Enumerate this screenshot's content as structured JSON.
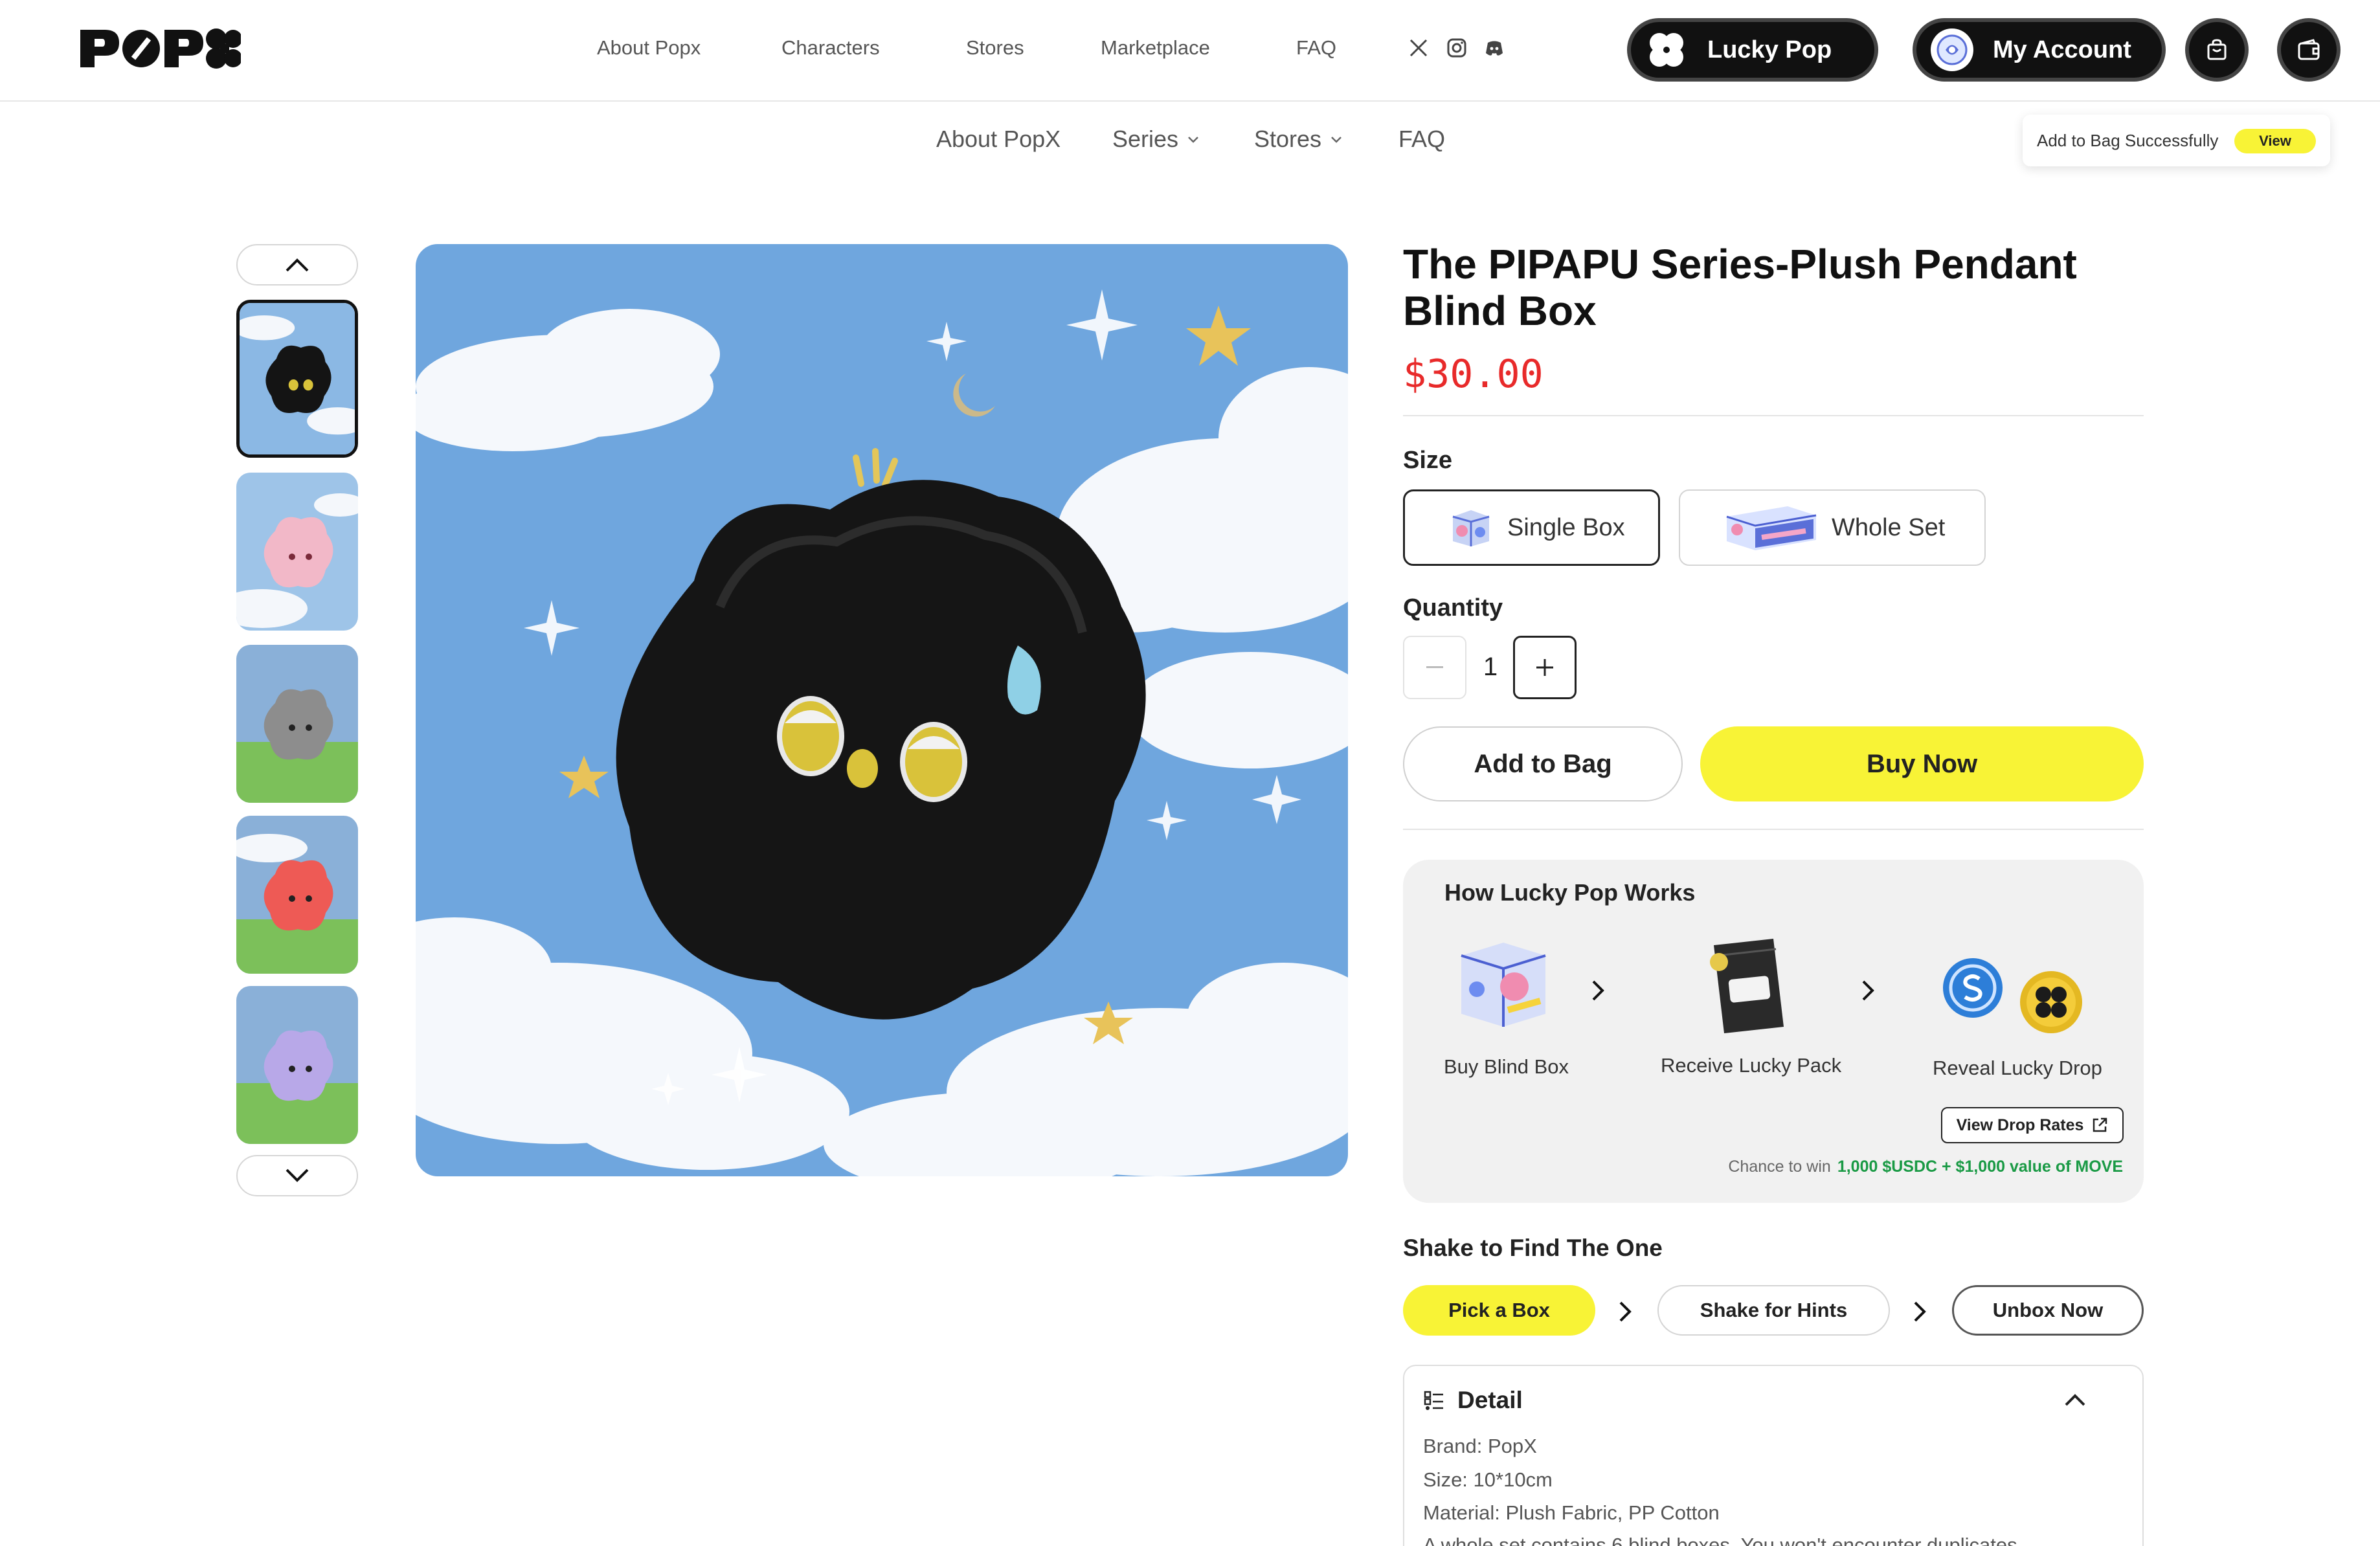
{
  "header": {
    "brand": "POPX",
    "nav": [
      "About Popx",
      "Characters",
      "Stores",
      "Marketplace",
      "FAQ"
    ],
    "social_icons": [
      "x-icon",
      "instagram-icon",
      "discord-icon"
    ],
    "lucky_pop_label": "Lucky Pop",
    "account_label": "My Account"
  },
  "subnav": {
    "about": "About PopX",
    "series": "Series",
    "stores": "Stores",
    "faq": "FAQ"
  },
  "toast": {
    "message": "Add to Bag Successfully",
    "action": "View"
  },
  "product": {
    "title": "The PIPAPU Series-Plush Pendant Blind Box",
    "price": "$30.00",
    "size_label": "Size",
    "sizes": [
      "Single Box",
      "Whole Set"
    ],
    "selected_size": "Single Box",
    "quantity_label": "Quantity",
    "quantity": "1",
    "add_to_bag": "Add to Bag",
    "buy_now": "Buy Now"
  },
  "how_it_works": {
    "title": "How Lucky Pop Works",
    "steps": [
      "Buy Blind Box",
      "Receive Lucky Pack",
      "Reveal Lucky Drop"
    ],
    "view_drop_rates": "View Drop Rates",
    "chance_text": "Chance to win",
    "chance_prize": "1,000 $USDC + $1,000 value of MOVE"
  },
  "shake": {
    "title": "Shake to Find The One",
    "steps": [
      "Pick a Box",
      "Shake for Hints",
      "Unbox Now"
    ]
  },
  "detail": {
    "title": "Detail",
    "lines": [
      "Brand: PopX",
      "Size: 10*10cm",
      "Material: Plush Fabric, PP Cotton",
      "A whole set contains 6 blind boxes. You won't encounter duplicates."
    ]
  },
  "colors": {
    "accent_yellow": "#f8f336",
    "price_red": "#e82a2a",
    "prize_green": "#1a9a45"
  }
}
